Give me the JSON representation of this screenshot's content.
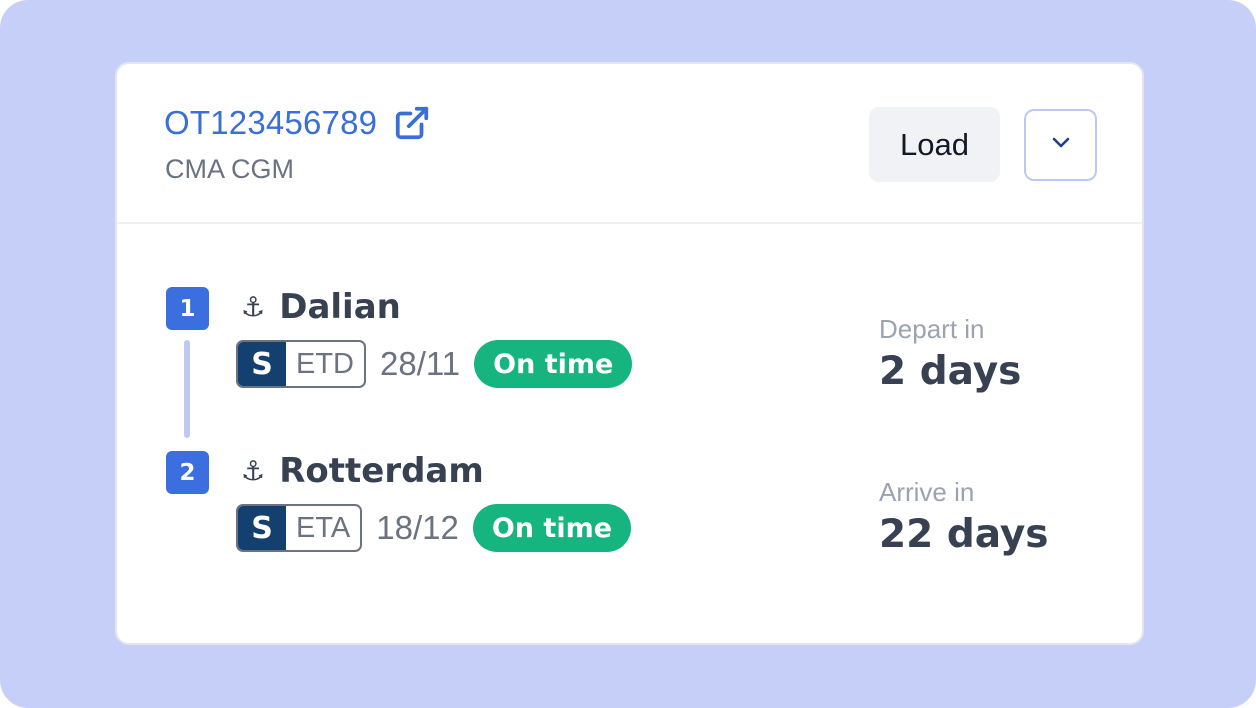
{
  "shipment": {
    "tracking_number": "OT123456789",
    "carrier": "CMA CGM",
    "load_label": "Load",
    "external_link_icon": "external-link-icon",
    "toggle_icon": "chevron-down-icon"
  },
  "stops": [
    {
      "number": "1",
      "port": "Dalian",
      "icon": "anchor-icon",
      "event_logo": "S",
      "event_code": "ETD",
      "date": "28/11",
      "status": "On time",
      "countdown_label": "Depart in",
      "countdown_value": "2 days"
    },
    {
      "number": "2",
      "port": "Rotterdam",
      "icon": "anchor-icon",
      "event_logo": "S",
      "event_code": "ETA",
      "date": "18/12",
      "status": "On time",
      "countdown_label": "Arrive in",
      "countdown_value": "22 days"
    }
  ],
  "colors": {
    "background": "#c5cff8",
    "accent": "#3b6fe0",
    "status_ok": "#16b47e",
    "logo_bg": "#14406f"
  }
}
